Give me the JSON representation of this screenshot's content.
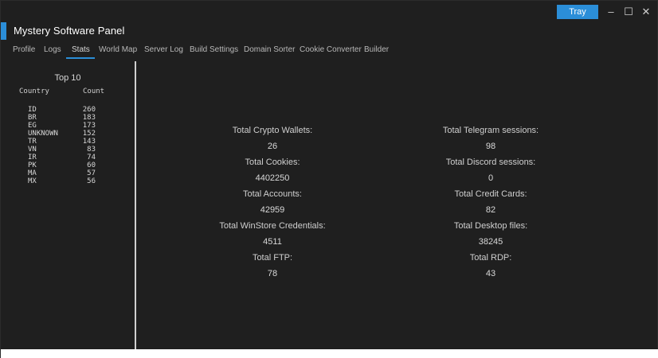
{
  "window": {
    "title": "Mystery Software Panel",
    "tray_label": "Tray",
    "controls": {
      "minimize": "–",
      "maximize": "☐",
      "close": "✕"
    }
  },
  "tabs": [
    {
      "label": "Profile"
    },
    {
      "label": "Logs"
    },
    {
      "label": "Stats"
    },
    {
      "label": "World Map"
    },
    {
      "label": "Server Log"
    },
    {
      "label": "Build Settings"
    },
    {
      "label": "Domain Sorter"
    },
    {
      "label": "Cookie Converter"
    },
    {
      "label": "Builder"
    }
  ],
  "active_tab": "Stats",
  "top10": {
    "title": "Top 10",
    "headers": {
      "country": "Country",
      "count": "Count"
    },
    "rows": [
      {
        "country": "ID",
        "count": "260"
      },
      {
        "country": "BR",
        "count": "183"
      },
      {
        "country": "EG",
        "count": "173"
      },
      {
        "country": "UNKNOWN",
        "count": "152"
      },
      {
        "country": "TR",
        "count": "143"
      },
      {
        "country": "VN",
        "count": "83"
      },
      {
        "country": "IR",
        "count": "74"
      },
      {
        "country": "PK",
        "count": "60"
      },
      {
        "country": "MA",
        "count": "57"
      },
      {
        "country": "MX",
        "count": "56"
      }
    ]
  },
  "stats": {
    "left": [
      {
        "label": "Total Crypto Wallets:",
        "value": "26"
      },
      {
        "label": "Total Cookies:",
        "value": "4402250"
      },
      {
        "label": "Total Accounts:",
        "value": "42959"
      },
      {
        "label": "Total WinStore Credentials:",
        "value": "4511"
      },
      {
        "label": "Total FTP:",
        "value": "78"
      }
    ],
    "right": [
      {
        "label": "Total Telegram sessions:",
        "value": "98"
      },
      {
        "label": "Total Discord sessions:",
        "value": "0"
      },
      {
        "label": "Total Credit Cards:",
        "value": "82"
      },
      {
        "label": "Total Desktop files:",
        "value": "38245"
      },
      {
        "label": "Total RDP:",
        "value": "43"
      }
    ]
  },
  "colors": {
    "accent": "#2b8ed8",
    "background": "#1f1f1f",
    "text": "#cfcfcf"
  }
}
